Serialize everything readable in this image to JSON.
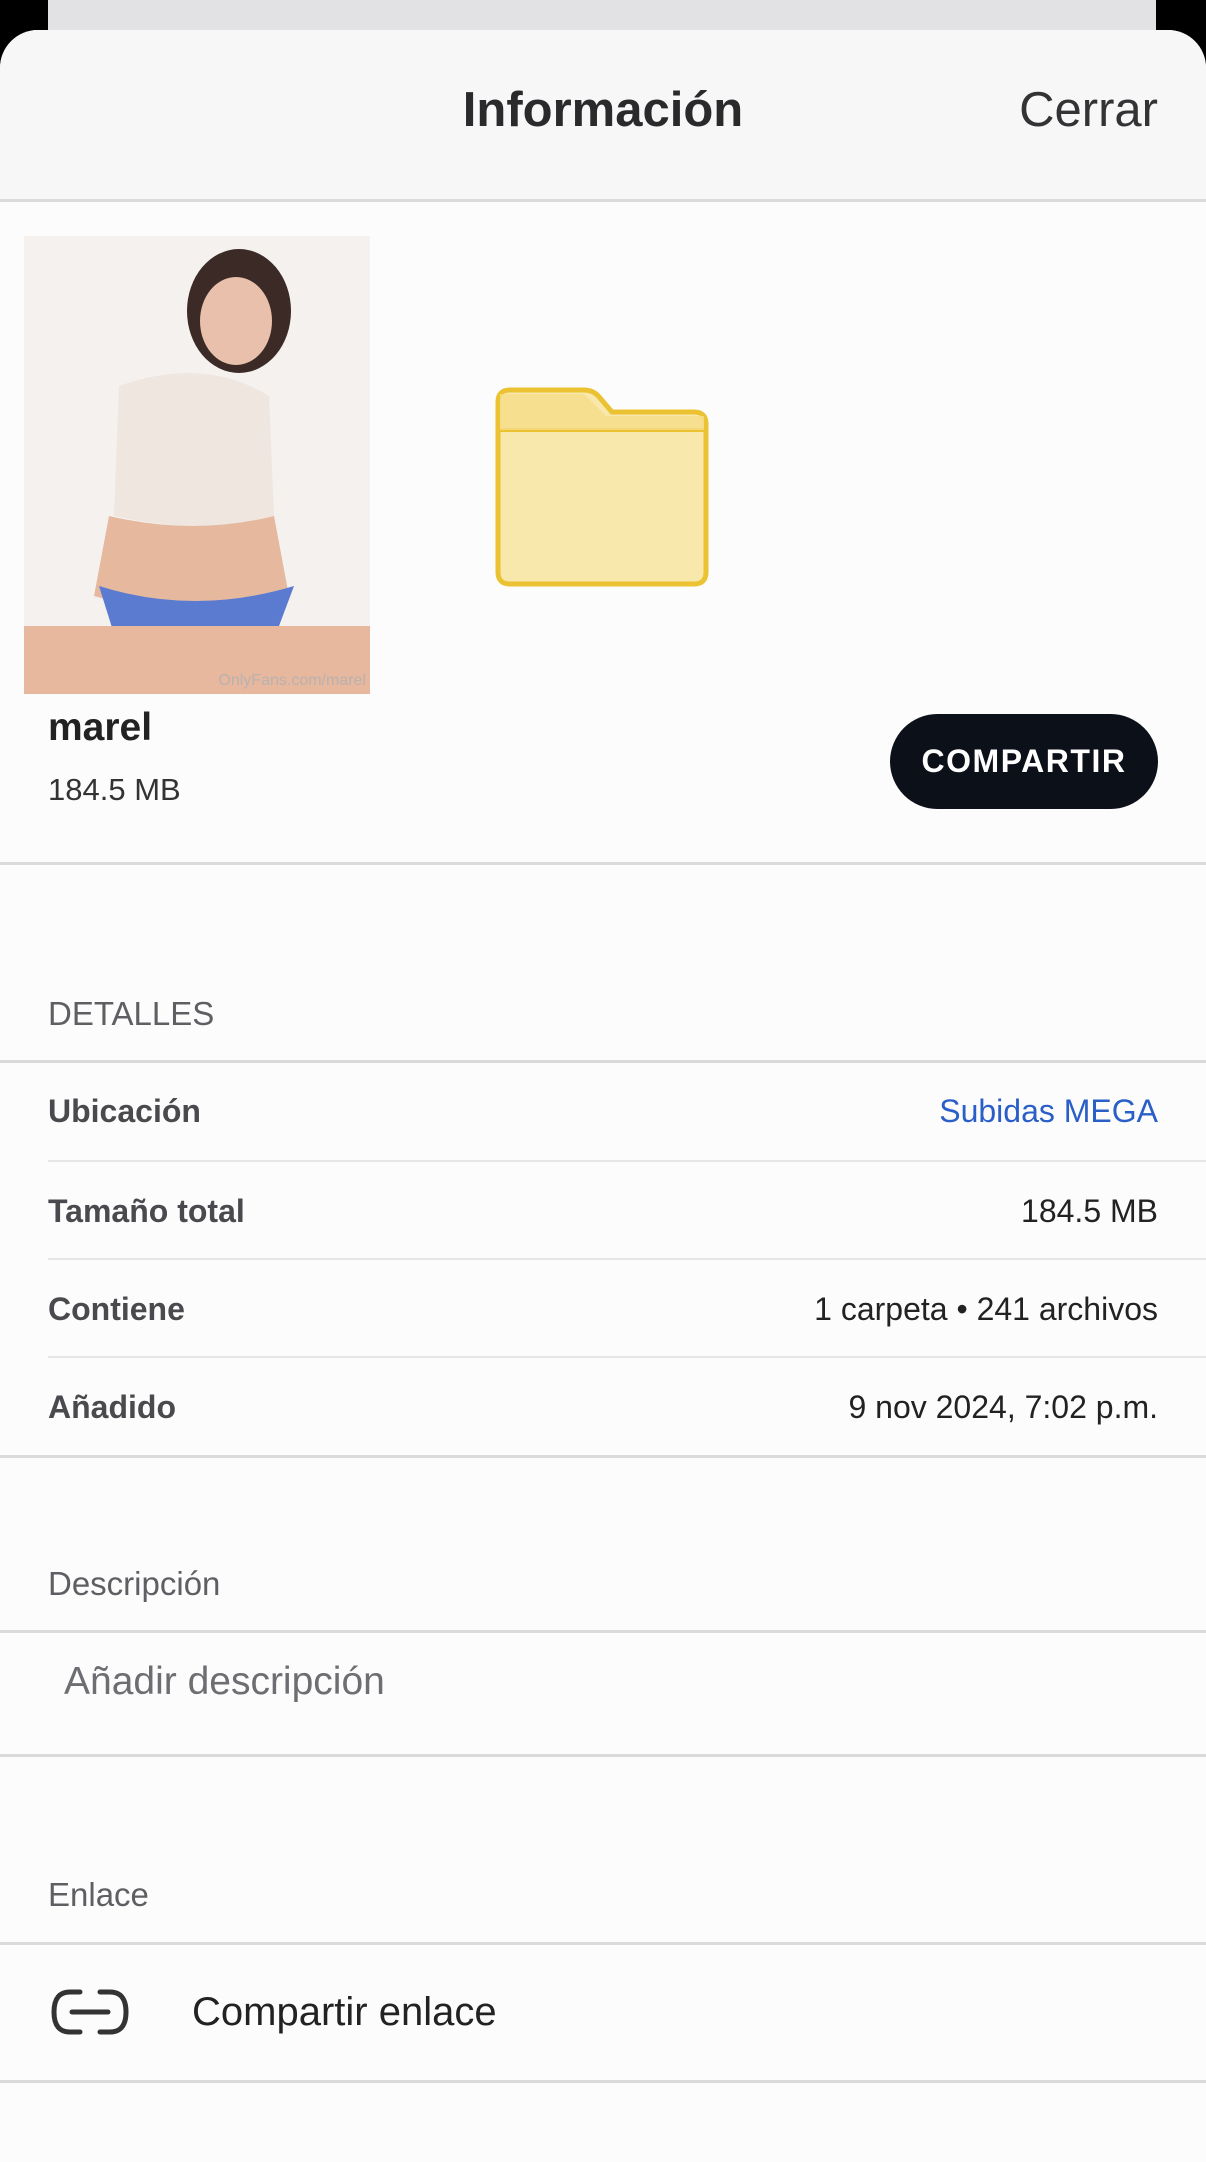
{
  "header": {
    "title": "Información",
    "close_label": "Cerrar"
  },
  "item": {
    "thumbnail_icon": "photo-thumbnail",
    "thumbnail_watermark": "OnlyFans.com/marel",
    "folder_icon": "folder-icon",
    "name": "marel",
    "size": "184.5 MB",
    "share_label": "COMPARTIR"
  },
  "details": {
    "title": "DETALLES",
    "rows": [
      {
        "label": "Ubicación",
        "value": "Subidas MEGA"
      },
      {
        "label": "Tamaño total",
        "value": "184.5 MB"
      },
      {
        "label": "Contiene",
        "value": "1 carpeta • 241 archivos"
      },
      {
        "label": "Añadido",
        "value": "9 nov 2024, 7:02 p.m."
      }
    ]
  },
  "description": {
    "title": "Descripción",
    "placeholder": "Añadir descripción"
  },
  "link": {
    "title": "Enlace",
    "icon": "link-icon",
    "share_label": "Compartir enlace"
  },
  "colors": {
    "accent_link": "#2a5fc8",
    "button_bg": "#0c1018",
    "folder_fill": "#f9e8ac",
    "folder_stroke": "#ebc231"
  }
}
